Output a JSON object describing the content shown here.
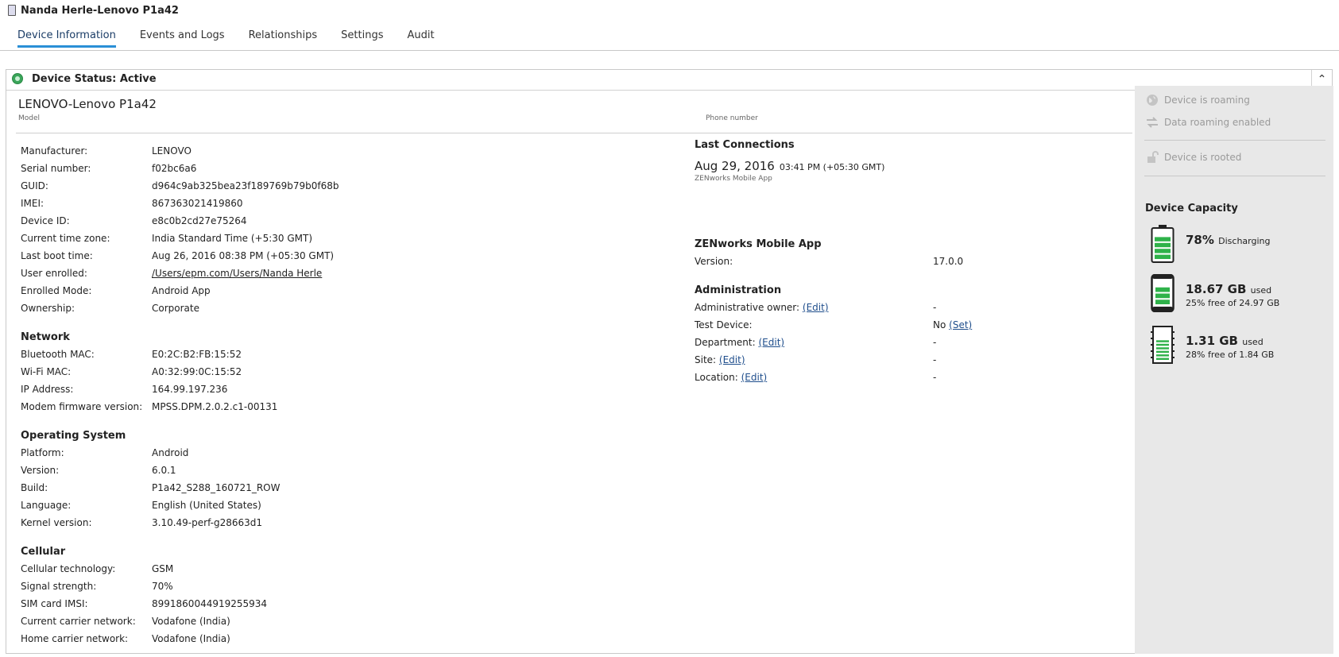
{
  "window": {
    "title": "Nanda Herle-Lenovo P1a42"
  },
  "tabs": [
    "Device Information",
    "Events and Logs",
    "Relationships",
    "Settings",
    "Audit"
  ],
  "status": {
    "label": "Device Status: Active",
    "collapse_glyph": "⌃"
  },
  "device": {
    "model": "LENOVO-Lenovo P1a42",
    "model_label": "Model",
    "phone_label": "Phone number"
  },
  "general": [
    {
      "label": "Manufacturer:",
      "value": "LENOVO"
    },
    {
      "label": "Serial number:",
      "value": "f02bc6a6"
    },
    {
      "label": "GUID:",
      "value": "d964c9ab325bea23f189769b79b0f68b"
    },
    {
      "label": "IMEI:",
      "value": "867363021419860"
    },
    {
      "label": "Device ID:",
      "value": "e8c0b2cd27e75264"
    },
    {
      "label": "Current time zone:",
      "value": "India Standard Time (+5:30 GMT)"
    },
    {
      "label": "Last boot time:",
      "value": "Aug 26, 2016 08:38 PM (+05:30 GMT)"
    },
    {
      "label": "User enrolled:",
      "value": "/Users/epm.com/Users/Nanda Herle"
    },
    {
      "label": "Enrolled Mode:",
      "value": "Android App"
    },
    {
      "label": "Ownership:",
      "value": "Corporate"
    }
  ],
  "network": {
    "title": "Network",
    "rows": [
      {
        "label": "Bluetooth MAC:",
        "value": "E0:2C:B2:FB:15:52"
      },
      {
        "label": "Wi-Fi MAC:",
        "value": "A0:32:99:0C:15:52"
      },
      {
        "label": "IP Address:",
        "value": "164.99.197.236"
      },
      {
        "label": "Modem firmware version:",
        "value": "MPSS.DPM.2.0.2.c1-00131"
      }
    ]
  },
  "os": {
    "title": "Operating System",
    "rows": [
      {
        "label": "Platform:",
        "value": "Android"
      },
      {
        "label": "Version:",
        "value": "6.0.1"
      },
      {
        "label": "Build:",
        "value": "P1a42_S288_160721_ROW"
      },
      {
        "label": "Language:",
        "value": "English (United States)"
      },
      {
        "label": "Kernel version:",
        "value": "3.10.49-perf-g28663d1"
      }
    ]
  },
  "cellular": {
    "title": "Cellular",
    "rows": [
      {
        "label": "Cellular technology:",
        "value": "GSM"
      },
      {
        "label": "Signal strength:",
        "value": "70%"
      },
      {
        "label": "SIM card IMSI:",
        "value": "8991860044919255934"
      },
      {
        "label": "Current carrier network:",
        "value": "Vodafone (India)"
      },
      {
        "label": "Home carrier network:",
        "value": "Vodafone (India)"
      }
    ]
  },
  "last_connections": {
    "title": "Last Connections",
    "date": "Aug 29, 2016",
    "time": "03:41 PM (+05:30 GMT)",
    "source": "ZENworks Mobile App"
  },
  "zen_app": {
    "title": "ZENworks Mobile App",
    "version_label": "Version:",
    "version": "17.0.0"
  },
  "administration": {
    "title": "Administration",
    "owner_label": "Administrative owner:",
    "owner_link": "(Edit)",
    "owner_value": "-",
    "test_label": "Test Device:",
    "test_value": "No",
    "test_link": "(Set)",
    "dept_label": "Department:",
    "dept_link": "(Edit)",
    "dept_value": "-",
    "site_label": "Site:",
    "site_link": "(Edit)",
    "site_value": "-",
    "loc_label": "Location:",
    "loc_link": "(Edit)",
    "loc_value": "-"
  },
  "flags": {
    "roaming": "Device is roaming",
    "data_roaming": "Data roaming enabled",
    "rooted": "Device is rooted"
  },
  "capacity": {
    "title": "Device Capacity",
    "battery": {
      "percent": "78%",
      "state": "Discharging",
      "level": 0.78
    },
    "internal": {
      "used": "18.67 GB",
      "used_word": "used",
      "free": "25% free of 24.97 GB",
      "used_fraction": 0.75
    },
    "sd": {
      "used": "1.31 GB",
      "used_word": "used",
      "free": "28% free of 1.84 GB",
      "used_fraction": 0.72
    }
  },
  "colors": {
    "accent": "#2a8fd6",
    "link": "#1f4e8c",
    "status_active": "#3aa55a",
    "capacity_green": "#2fb24a"
  }
}
